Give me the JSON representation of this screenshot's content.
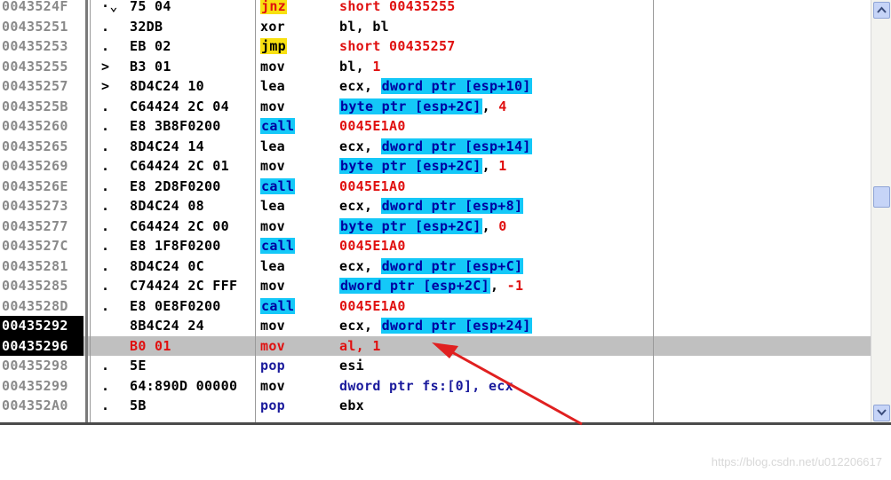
{
  "rows": [
    {
      "addr": "0043524F",
      "mark": "·⌄",
      "hex": "75 04",
      "mn": "jnz",
      "ops": [
        {
          "t": "short 00435255",
          "c": "red"
        }
      ],
      "mn_style": "yellow-red"
    },
    {
      "addr": "00435251",
      "mark": ".",
      "hex": "32DB",
      "mn": "xor",
      "ops": [
        {
          "t": "bl, bl"
        }
      ]
    },
    {
      "addr": "00435253",
      "mark": ".",
      "hex": "EB 02",
      "mn": "jmp",
      "ops": [
        {
          "t": "short 00435257",
          "c": "red"
        }
      ],
      "mn_style": "yellow"
    },
    {
      "addr": "00435255",
      "mark": ">",
      "hex": "B3 01",
      "mn": "mov",
      "ops": [
        {
          "t": "bl, "
        },
        {
          "t": "1",
          "c": "red"
        }
      ]
    },
    {
      "addr": "00435257",
      "mark": ">",
      "hex": "8D4C24 10",
      "mn": "lea",
      "ops": [
        {
          "t": "ecx, "
        },
        {
          "t": "dword ptr [esp+10]",
          "c": "cyan"
        }
      ]
    },
    {
      "addr": "0043525B",
      "mark": ".",
      "hex": "C64424 2C 04",
      "mn": "mov",
      "ops": [
        {
          "t": "byte ptr [esp+2C]",
          "c": "cyan"
        },
        {
          "t": ", "
        },
        {
          "t": "4",
          "c": "red"
        }
      ]
    },
    {
      "addr": "00435260",
      "mark": ".",
      "hex": "E8 3B8F0200",
      "mn": "call",
      "ops": [
        {
          "t": "0045E1A0",
          "c": "red"
        }
      ],
      "mn_style": "cyan"
    },
    {
      "addr": "00435265",
      "mark": ".",
      "hex": "8D4C24 14",
      "mn": "lea",
      "ops": [
        {
          "t": "ecx, "
        },
        {
          "t": "dword ptr [esp+14]",
          "c": "cyan"
        }
      ]
    },
    {
      "addr": "00435269",
      "mark": ".",
      "hex": "C64424 2C 01",
      "mn": "mov",
      "ops": [
        {
          "t": "byte ptr [esp+2C]",
          "c": "cyan"
        },
        {
          "t": ", "
        },
        {
          "t": "1",
          "c": "red"
        }
      ]
    },
    {
      "addr": "0043526E",
      "mark": ".",
      "hex": "E8 2D8F0200",
      "mn": "call",
      "ops": [
        {
          "t": "0045E1A0",
          "c": "red"
        }
      ],
      "mn_style": "cyan"
    },
    {
      "addr": "00435273",
      "mark": ".",
      "hex": "8D4C24 08",
      "mn": "lea",
      "ops": [
        {
          "t": "ecx, "
        },
        {
          "t": "dword ptr [esp+8]",
          "c": "cyan"
        }
      ]
    },
    {
      "addr": "00435277",
      "mark": ".",
      "hex": "C64424 2C 00",
      "mn": "mov",
      "ops": [
        {
          "t": "byte ptr [esp+2C]",
          "c": "cyan"
        },
        {
          "t": ", "
        },
        {
          "t": "0",
          "c": "red"
        }
      ]
    },
    {
      "addr": "0043527C",
      "mark": ".",
      "hex": "E8 1F8F0200",
      "mn": "call",
      "ops": [
        {
          "t": "0045E1A0",
          "c": "red"
        }
      ],
      "mn_style": "cyan"
    },
    {
      "addr": "00435281",
      "mark": ".",
      "hex": "8D4C24 0C",
      "mn": "lea",
      "ops": [
        {
          "t": "ecx, "
        },
        {
          "t": "dword ptr [esp+C]",
          "c": "cyan"
        }
      ]
    },
    {
      "addr": "00435285",
      "mark": ".",
      "hex": "C74424 2C FFF",
      "mn": "mov",
      "ops": [
        {
          "t": "dword ptr [esp+2C]",
          "c": "cyan"
        },
        {
          "t": ", "
        },
        {
          "t": "-1",
          "c": "red"
        }
      ]
    },
    {
      "addr": "0043528D",
      "mark": ".",
      "hex": "E8 0E8F0200",
      "mn": "call",
      "ops": [
        {
          "t": "0045E1A0",
          "c": "red"
        }
      ],
      "mn_style": "cyan"
    },
    {
      "addr": "00435292",
      "mark": "",
      "hex": "8B4C24 24",
      "mn": "mov",
      "ops": [
        {
          "t": "ecx, "
        },
        {
          "t": "dword ptr [esp+24]",
          "c": "cyan"
        }
      ],
      "addr_hl": true
    },
    {
      "addr": "00435296",
      "mark": "",
      "hex": "B0 01",
      "mn": "mov",
      "ops": [
        {
          "t": "al, 1"
        }
      ],
      "addr_hl": true,
      "selected": true,
      "all_red": true
    },
    {
      "addr": "00435298",
      "mark": ".",
      "hex": "5E",
      "mn": "pop",
      "ops": [
        {
          "t": "esi"
        }
      ],
      "mn_style": "navy"
    },
    {
      "addr": "00435299",
      "mark": ".",
      "hex": "64:890D 00000",
      "mn": "mov",
      "ops": [
        {
          "t": "dword ptr fs:[0], ecx",
          "c": "navy"
        }
      ]
    },
    {
      "addr": "004352A0",
      "mark": ".",
      "hex": "5B",
      "mn": "pop",
      "ops": [
        {
          "t": "ebx"
        }
      ],
      "mn_style": "navy"
    }
  ],
  "watermark": "https://blog.csdn.net/u012206617",
  "colors": {
    "highlight_cyan": "#14c8f8",
    "highlight_yellow": "#f8e010",
    "operand_red": "#e01010",
    "arrow_red": "#e02020",
    "selection_gray": "#c0c0c0"
  },
  "icons": {
    "scroll_up": "up-arrow-icon",
    "scroll_down": "down-arrow-icon",
    "annotation": "red-arrow-annotation"
  }
}
